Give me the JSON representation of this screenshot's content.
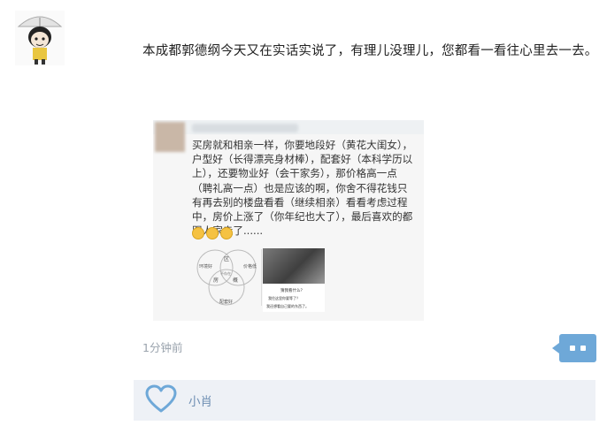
{
  "post": {
    "text": "本成都郭德纲今天又在实话实说了，有理儿没理儿，您都看一看往心里去一去。",
    "timestamp": "1分钟前"
  },
  "shared_image": {
    "body": "买房就和相亲一样，你要地段好（黄花大闺女），户型好（长得漂亮身材棒），配套好（本科学历以上），还要物业好（会干家务），那价格高一点（聘礼高一点）也是应该的啊，你舍不得花钱只有再去别的楼盘看看（继续相亲）看看考虑过程中，房价上涨了（你年纪也大了），最后喜欢的都跟人家走了......",
    "emoji_count": 3,
    "venn": {
      "top_left": "环境好",
      "top_center": "区",
      "top_right": "价格低",
      "center": "不存在",
      "mid_left": "房",
      "mid_right": "概",
      "bottom": "配套好"
    },
    "caption": {
      "line1": "猜我看什么？",
      "line2": "我住这里你要等了？",
      "line3": "我还想看自己要的东西了。"
    }
  },
  "likes": {
    "names": "小肖"
  },
  "colors": {
    "accent": "#6ea8d8",
    "like_name": "#6f8fb3",
    "timestamp": "#9aa3ad",
    "like_bar_bg": "#eef1f6"
  },
  "icons": {
    "avatar": "cartoon-girl-umbrella-avatar",
    "comment": "comment-dots-icon",
    "like": "heart-outline-icon"
  }
}
